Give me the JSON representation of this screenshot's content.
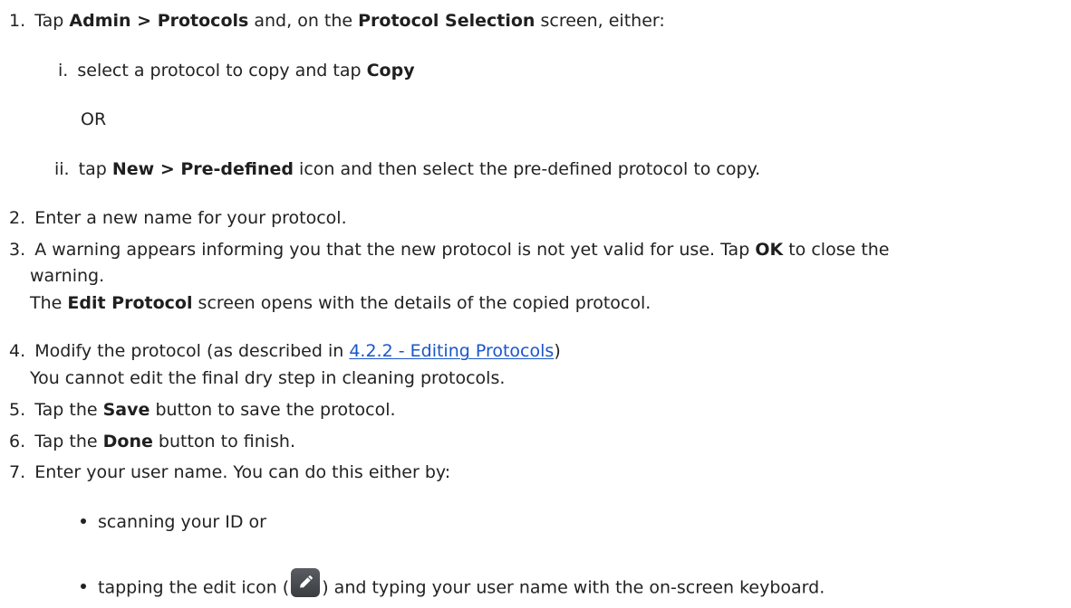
{
  "steps": [
    {
      "num": "1.",
      "t1": "Tap ",
      "b1": "Admin > Protocols",
      "t2": " and, on the ",
      "b2": "Protocol Selection",
      "t3": " screen, either:",
      "sub": [
        {
          "num": "i.",
          "t1": "select a protocol to copy and tap ",
          "b1": "Copy"
        },
        {
          "or": "OR"
        },
        {
          "num": "ii.",
          "t1": "tap ",
          "b1": "New > Pre-defined",
          "t2": " icon and then select the pre-defined protocol to copy."
        }
      ]
    },
    {
      "num": "2.",
      "t1": "Enter a new name for your protocol."
    },
    {
      "num": "3.",
      "t1": "A warning appears informing you that the new protocol is not yet valid for use. Tap ",
      "b1": "OK",
      "t2": " to close the",
      "t3": "warning.",
      "n1": "The ",
      "nb": "Edit Protocol",
      "n2": " screen opens with the details of the copied protocol."
    },
    {
      "num": "4.",
      "t1": "Modify the protocol (as described in ",
      "link": "4.2.2 - Editing Protocols",
      "t2": ")",
      "note": "You cannot edit the final dry step in cleaning protocols."
    },
    {
      "num": "5.",
      "t1": "Tap the ",
      "b1": "Save",
      "t2": " button to save the protocol."
    },
    {
      "num": "6.",
      "t1": "Tap the ",
      "b1": "Done",
      "t2": " button to finish."
    },
    {
      "num": "7.",
      "t1": "Enter your user name. You can do this either by:",
      "bullets": [
        {
          "t1": "scanning your ID or"
        },
        {
          "t1": "tapping the edit icon (",
          "t2": ") and typing your user name with the on-screen keyboard."
        }
      ]
    }
  ],
  "icons": {
    "edit": "pencil-edit-icon"
  }
}
